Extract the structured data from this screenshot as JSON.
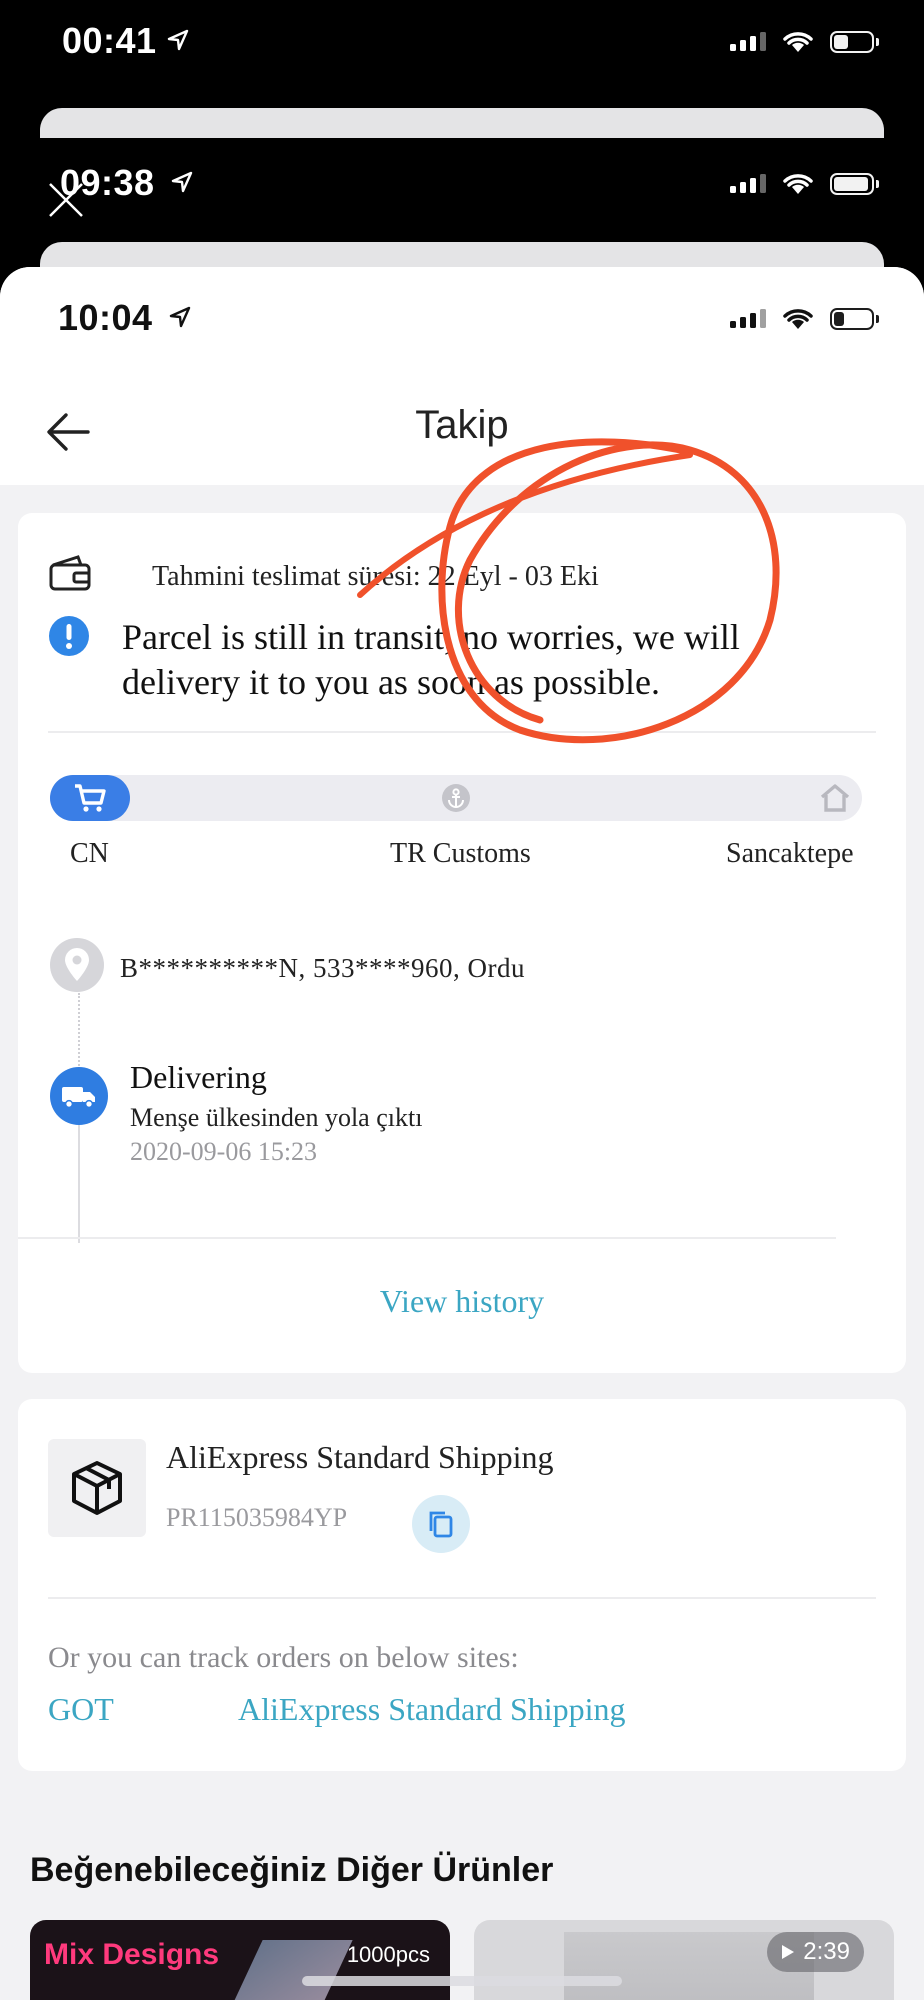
{
  "status_bars": [
    {
      "time": "00:41"
    },
    {
      "time": "09:38"
    },
    {
      "time": "10:04"
    }
  ],
  "nav": {
    "title": "Takip"
  },
  "delivery": {
    "estimate_text": "Tahmini teslimat süresi: 22 Eyl - 03 Eki",
    "notice": "Parcel is still in transit, no worries, we will delivery it to you as soon as possible."
  },
  "progress": {
    "stages": [
      "CN",
      "TR Customs",
      "Sancaktepe"
    ],
    "current_stage_index": 0
  },
  "recipient": {
    "address_line": "B**********N,  533****960,  Ordu"
  },
  "event": {
    "status": "Delivering",
    "detail": "Menşe ülkesinden yola çıktı",
    "time": "2020-09-06 15:23"
  },
  "view_history_label": "View history",
  "shipping": {
    "carrier": "AliExpress Standard Shipping",
    "tracking_no": "PR115035984YP",
    "alt_label": "Or you can track orders on below sites:",
    "alt_links": [
      "GOT",
      "AliExpress Standard Shipping"
    ]
  },
  "recommendations": {
    "title": "Beğenebileceğiniz Diğer Ürünler",
    "card1_badge": "Mix Designs",
    "card1_qty": "1000pcs",
    "card2_duration": "2:39"
  },
  "icons": {
    "back": "arrow-left-icon",
    "estimate": "wallet-icon",
    "info": "info-icon",
    "cart": "cart-icon",
    "customs": "anchor-icon",
    "home": "home-icon",
    "pin": "location-pin-icon",
    "truck": "truck-icon",
    "package": "package-icon",
    "copy": "copy-icon"
  },
  "colors": {
    "accent_blue": "#3a7ee6",
    "link_teal": "#3ba6c3",
    "scribble_red": "#f0512b"
  }
}
